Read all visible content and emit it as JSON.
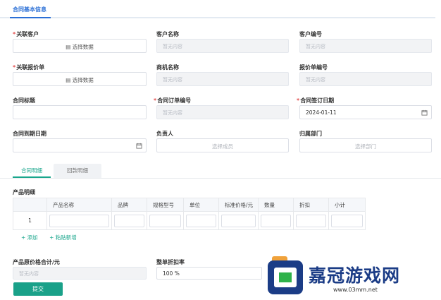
{
  "tab": {
    "label": "合同基本信息"
  },
  "fields": {
    "related_customer": {
      "label": "关联客户",
      "button": "选择数据"
    },
    "customer_name": {
      "label": "客户名称",
      "placeholder": "暂无内容"
    },
    "customer_no": {
      "label": "客户编号",
      "placeholder": "暂无内容"
    },
    "related_quote": {
      "label": "关联报价单",
      "button": "选择数据"
    },
    "opportunity_name": {
      "label": "商机名称",
      "placeholder": "暂无内容"
    },
    "quote_no": {
      "label": "报价单编号",
      "placeholder": "暂无内容"
    },
    "contract_title": {
      "label": "合同标题"
    },
    "contract_order_no": {
      "label": "合同订单编号",
      "placeholder": "暂无内容"
    },
    "sign_date": {
      "label": "合同签订日期",
      "value": "2024-01-11"
    },
    "expiry_date": {
      "label": "合同到期日期"
    },
    "owner": {
      "label": "负责人",
      "button": "选择成员"
    },
    "department": {
      "label": "归属部门",
      "button": "选择部门"
    }
  },
  "subtabs": [
    "合同明细",
    "回款明细"
  ],
  "products": {
    "title": "产品明细",
    "columns": [
      "产品名称",
      "品牌",
      "规格型号",
      "单位",
      "标准价格/元",
      "数量",
      "折扣",
      "小计"
    ],
    "row_index": "1",
    "add_label": "+ 添加",
    "paste_label": "+ 粘贴新增"
  },
  "totals": {
    "original_total_label": "产品原价格合计/元",
    "original_total_placeholder": "暂无内容",
    "discount_label": "整单折扣率",
    "discount_value": "100 %"
  },
  "submit": "提交",
  "watermark": {
    "brand": "嘉冠游戏网",
    "url": "www.03mm.net"
  },
  "colors": {
    "primary": "#2b6fd6",
    "accent": "#1aa189"
  }
}
